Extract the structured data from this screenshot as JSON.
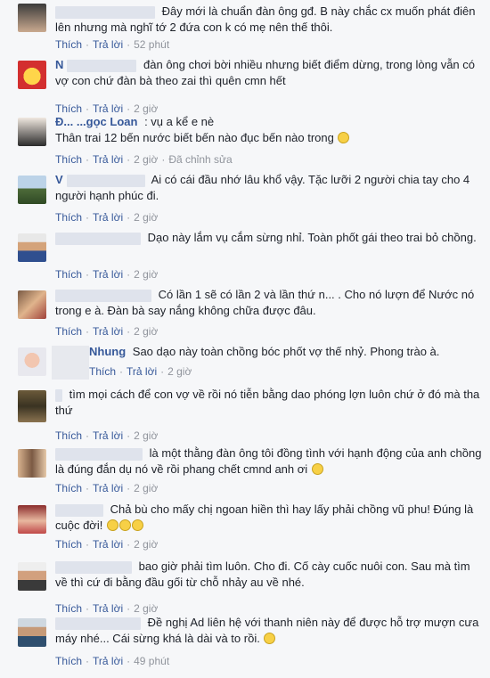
{
  "labels": {
    "like": "Thích",
    "reply": "Trả lời",
    "edited": "Đã chỉnh sửa"
  },
  "comments": [
    {
      "name": "",
      "text": "Đây mới là chuẩn đàn ông gđ. B này chắc cx muốn phát điên lên nhưng mà nghĩ tớ 2 đứa con k có mẹ nên thế thôi.",
      "time": "52 phút",
      "emoji": 0
    },
    {
      "name": "N",
      "text": "đàn ông chơi bời nhiều nhưng biết điểm dừng, trong lòng vẫn có vợ con chứ đàn bà theo zai thì quên cmn hết",
      "time": "2 giờ",
      "emoji": 0
    },
    {
      "name": "Đ... ...gọc Loan",
      "text": ": vụ a kể e nè",
      "text2": "Thân trai 12 bến nước biết bến nào đục bến nào trong",
      "time": "2 giờ",
      "edited": true,
      "emoji": 1
    },
    {
      "name": "V",
      "text": "Ai có cái đầu nhớ lâu khổ vậy. Tặc lưỡi 2 người chia tay cho 4 người hạnh phúc đi.",
      "time": "2 giờ",
      "emoji": 0
    },
    {
      "name": "",
      "text": "Dạo này lắm vụ cắm sừng nhỉ. Toàn phốt gái theo trai bỏ chồng.",
      "time": "2 giờ",
      "emoji": 0
    },
    {
      "name": "",
      "text": "Có lần 1 sẽ có lần 2 và lần thứ n... . Cho nó lượn để Nước nó trong e à. Đàn bà say nắng không chữa được đâu.",
      "time": "2 giờ",
      "emoji": 0
    },
    {
      "name": "Nhung",
      "text": "Sao dạo này toàn chồng bóc phốt vợ thế nhỷ. Phong trào à.",
      "time": "2 giờ",
      "emoji": 0
    },
    {
      "name": "",
      "text": "tìm mọi cách để con vợ về rồi nó tiễn bằng dao phóng lợn luôn chứ ở đó mà tha thứ",
      "time": "2 giờ",
      "emoji": 0
    },
    {
      "name": "",
      "text": "là một thằng đàn ông tôi đồng tình với hạnh động của anh chồng là đúng đắn dụ nó về rồi phang chết cmnd anh ơi",
      "time": "2 giờ",
      "emoji": 1
    },
    {
      "name": "",
      "text": "Chả bù cho mấy chị ngoan hiền thì hay lấy phải chồng vũ phu! Đúng là cuộc đời!",
      "time": "2 giờ",
      "emoji": 3
    },
    {
      "name": "",
      "text": "bao giờ phải tìm luôn. Cho đi. Cố cày cuốc nuôi con. Sau mà tìm về thì cứ đi bằng đầu gối từ chỗ nhảy au về nhé.",
      "time": "2 giờ",
      "emoji": 0
    },
    {
      "name": "",
      "text": "Đề nghị Ad liên hệ với thanh niên này để được hỗ trợ mượn cưa máy nhé... Cái sừng khá là dài và to rồi.",
      "time": "49 phút",
      "emoji": 1
    }
  ]
}
